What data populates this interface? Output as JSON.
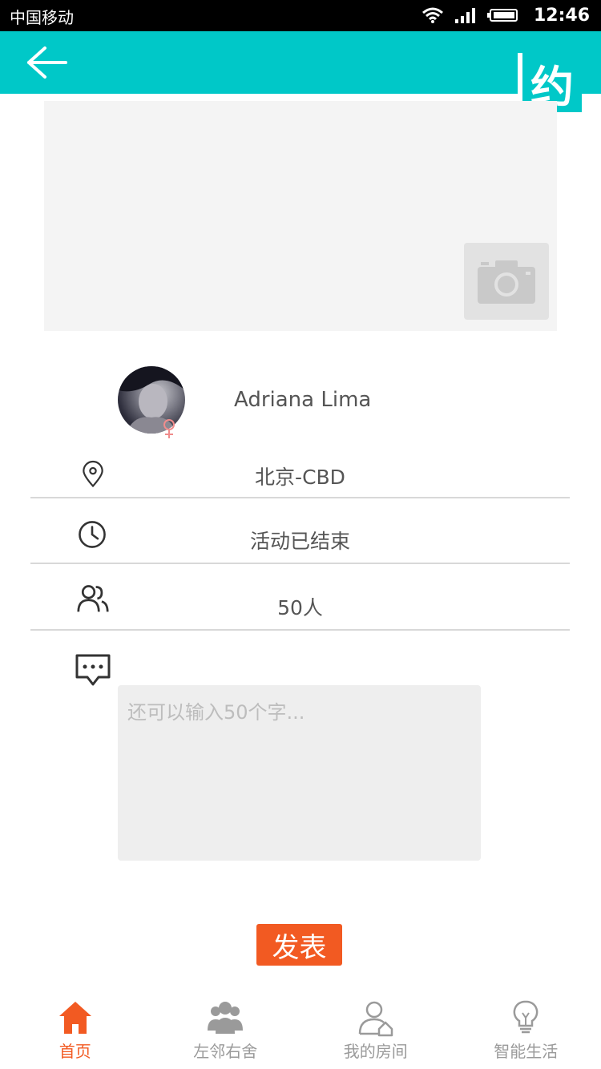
{
  "status_bar": {
    "carrier": "中国移动",
    "time": "12:46"
  },
  "header": {
    "badge": "约"
  },
  "profile": {
    "name": "Adriana Lima",
    "gender_symbol": "♀"
  },
  "info": {
    "location": "北京-CBD",
    "status": "活动已结束",
    "people": "50人"
  },
  "comment": {
    "placeholder": "还可以输入50个字..."
  },
  "publish": {
    "label": "发表"
  },
  "nav": {
    "items": [
      {
        "label": "首页",
        "icon": "home-icon",
        "active": true
      },
      {
        "label": "左邻右舍",
        "icon": "neighbors-icon",
        "active": false
      },
      {
        "label": "我的房间",
        "icon": "my-room-icon",
        "active": false
      },
      {
        "label": "智能生活",
        "icon": "smart-life-icon",
        "active": false
      }
    ]
  },
  "colors": {
    "accent": "#00c8c8",
    "primary_orange": "#f25a22",
    "nav_inactive": "#9a9a9a"
  }
}
